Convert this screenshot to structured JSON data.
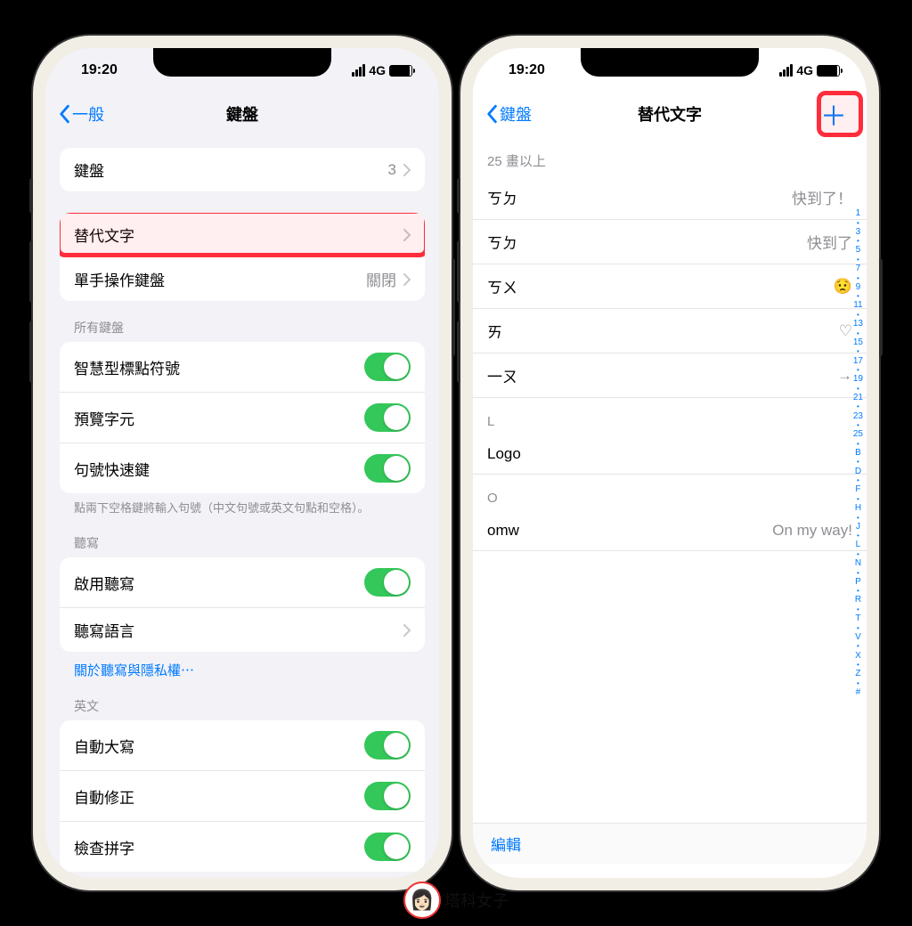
{
  "status": {
    "time": "19:20",
    "carrier": "4G"
  },
  "left": {
    "back": "一般",
    "title": "鍵盤",
    "rows": {
      "keyboards": {
        "label": "鍵盤",
        "value": "3"
      },
      "text_replacement": {
        "label": "替代文字"
      },
      "one_handed": {
        "label": "單手操作鍵盤",
        "value": "關閉"
      }
    },
    "all_keyboards_header": "所有鍵盤",
    "toggles": {
      "smart_punct": "智慧型標點符號",
      "preview": "預覽字元",
      "period_shortcut": "句號快速鍵"
    },
    "period_footer": "點兩下空格鍵將輸入句號（中文句號或英文句點和空格）。",
    "dictation_header": "聽寫",
    "dictation_enable": "啟用聽寫",
    "dictation_lang": "聽寫語言",
    "dictation_link": "關於聽寫與隱私權⋯",
    "english_header": "英文",
    "english": {
      "auto_cap": "自動大寫",
      "auto_correct": "自動修正",
      "check_spell": "檢查拼字"
    }
  },
  "right": {
    "back": "鍵盤",
    "title": "替代文字",
    "section_25": "25 畫以上",
    "items_25": [
      {
        "shortcut": "ㄎㄉ",
        "phrase": "快到了！"
      },
      {
        "shortcut": "ㄎㄉ",
        "phrase": "快到了"
      },
      {
        "shortcut": "ㄎㄨ",
        "phrase": "😟"
      },
      {
        "shortcut": "ㄞ",
        "phrase": "♡"
      },
      {
        "shortcut": "一ㄡ",
        "phrase": "→"
      }
    ],
    "section_L": "L",
    "items_L": [
      {
        "shortcut": "Logo",
        "phrase": ""
      }
    ],
    "section_O": "O",
    "items_O": [
      {
        "shortcut": "omw",
        "phrase": "On my way!"
      }
    ],
    "index": [
      "1",
      "•",
      "3",
      "•",
      "5",
      "•",
      "7",
      "•",
      "9",
      "•",
      "11",
      "•",
      "13",
      "•",
      "15",
      "•",
      "17",
      "•",
      "19",
      "•",
      "21",
      "•",
      "23",
      "•",
      "25",
      "•",
      "B",
      "•",
      "D",
      "•",
      "F",
      "•",
      "H",
      "•",
      "J",
      "•",
      "L",
      "•",
      "N",
      "•",
      "P",
      "•",
      "R",
      "•",
      "T",
      "•",
      "V",
      "•",
      "X",
      "•",
      "Z",
      "•",
      "#"
    ],
    "edit": "編輯"
  },
  "watermark_text": "塔科女子"
}
